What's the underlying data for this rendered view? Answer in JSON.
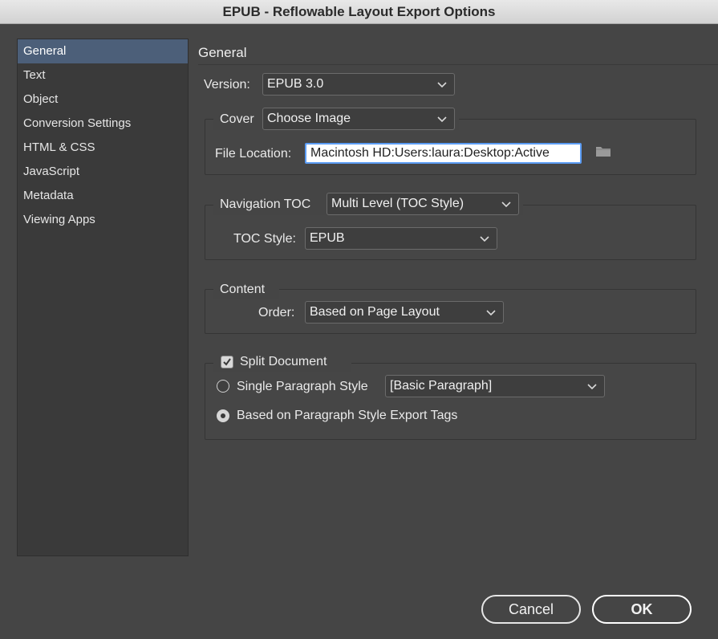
{
  "window": {
    "title": "EPUB - Reflowable Layout Export Options"
  },
  "sidebar": {
    "items": [
      {
        "label": "General",
        "selected": true
      },
      {
        "label": "Text"
      },
      {
        "label": "Object"
      },
      {
        "label": "Conversion Settings"
      },
      {
        "label": "HTML & CSS"
      },
      {
        "label": "JavaScript"
      },
      {
        "label": "Metadata"
      },
      {
        "label": "Viewing Apps"
      }
    ]
  },
  "general": {
    "title": "General",
    "version": {
      "label": "Version:",
      "value": "EPUB 3.0"
    },
    "cover": {
      "label": "Cover",
      "value": "Choose Image",
      "file_location_label": "File Location:",
      "file_location_value": "Macintosh HD:Users:laura:Desktop:Active",
      "browse_icon": "folder-icon"
    },
    "navigation": {
      "label": "Navigation TOC",
      "value": "Multi Level (TOC Style)",
      "toc_style_label": "TOC Style:",
      "toc_style_value": "EPUB"
    },
    "content": {
      "label": "Content",
      "order_label": "Order:",
      "order_value": "Based on Page Layout"
    },
    "split": {
      "label": "Split Document",
      "checked": true,
      "single_style_label": "Single Paragraph Style",
      "single_style_value": "[Basic Paragraph]",
      "export_tags_label": "Based on Paragraph Style Export Tags",
      "selected_option": "export_tags"
    }
  },
  "buttons": {
    "cancel": "Cancel",
    "ok": "OK"
  },
  "colors": {
    "background": "#454545",
    "selection": "#4c5f79",
    "focus_ring": "#5b9cf4"
  }
}
